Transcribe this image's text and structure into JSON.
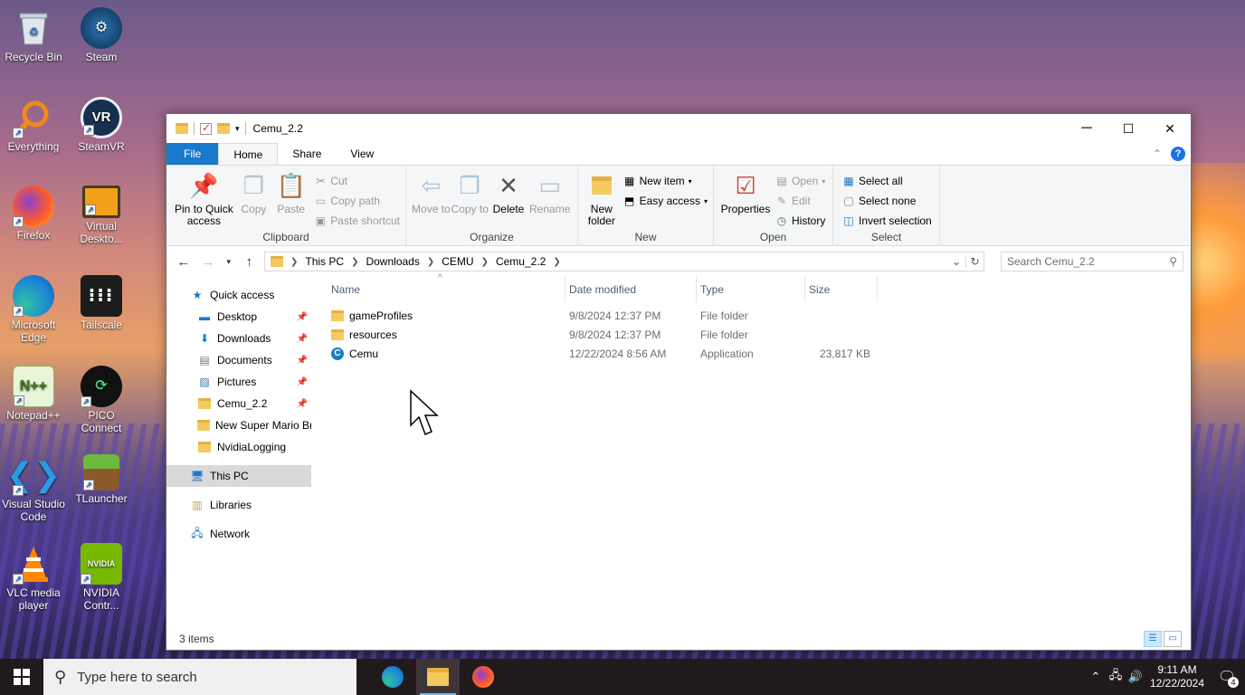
{
  "desktop": {
    "icons": [
      {
        "label": "Recycle Bin"
      },
      {
        "label": "Steam"
      },
      {
        "label": "Everything"
      },
      {
        "label": "SteamVR"
      },
      {
        "label": "Firefox"
      },
      {
        "label": "Virtual Deskto..."
      },
      {
        "label": "Microsoft Edge"
      },
      {
        "label": "Tailscale"
      },
      {
        "label": "Notepad++"
      },
      {
        "label": "PICO Connect"
      },
      {
        "label": "Visual Studio Code"
      },
      {
        "label": "TLauncher"
      },
      {
        "label": "VLC media player"
      },
      {
        "label": "NVIDIA Contr..."
      }
    ]
  },
  "window": {
    "title": "Cemu_2.2",
    "controls": {
      "minimize": "─",
      "maximize": "☐",
      "close": "✕"
    }
  },
  "ribbon": {
    "tabs": [
      "File",
      "Home",
      "Share",
      "View"
    ],
    "active_tab": "Home",
    "clipboard": {
      "label": "Clipboard",
      "pin": "Pin to Quick access",
      "copy": "Copy",
      "paste": "Paste",
      "cut": "Cut",
      "copy_path": "Copy path",
      "paste_shortcut": "Paste shortcut"
    },
    "organize": {
      "label": "Organize",
      "move_to": "Move to",
      "copy_to": "Copy to",
      "delete": "Delete",
      "rename": "Rename"
    },
    "new": {
      "label": "New",
      "new_folder": "New folder",
      "new_item": "New item",
      "easy_access": "Easy access"
    },
    "open": {
      "label": "Open",
      "properties": "Properties",
      "open": "Open",
      "edit": "Edit",
      "history": "History"
    },
    "select": {
      "label": "Select",
      "select_all": "Select all",
      "select_none": "Select none",
      "invert": "Invert selection"
    }
  },
  "address": {
    "crumbs": [
      "This PC",
      "Downloads",
      "CEMU",
      "Cemu_2.2"
    ],
    "search_placeholder": "Search Cemu_2.2"
  },
  "navpane": {
    "quick_access": "Quick access",
    "pinned": [
      {
        "label": "Desktop",
        "icon": "desktop-icon",
        "pinned": true
      },
      {
        "label": "Downloads",
        "icon": "download-icon",
        "pinned": true
      },
      {
        "label": "Documents",
        "icon": "document-icon",
        "pinned": true
      },
      {
        "label": "Pictures",
        "icon": "pictures-icon",
        "pinned": true
      },
      {
        "label": "Cemu_2.2",
        "icon": "folder-icon",
        "pinned": true
      },
      {
        "label": "New Super Mario Br",
        "icon": "folder-icon",
        "pinned": false
      },
      {
        "label": "NvidiaLogging",
        "icon": "folder-icon",
        "pinned": false
      }
    ],
    "this_pc": "This PC",
    "libraries": "Libraries",
    "network": "Network"
  },
  "files": {
    "columns": {
      "name": "Name",
      "date": "Date modified",
      "type": "Type",
      "size": "Size"
    },
    "rows": [
      {
        "name": "gameProfiles",
        "date": "9/8/2024 12:37 PM",
        "type": "File folder",
        "size": "",
        "icon": "folder-icon"
      },
      {
        "name": "resources",
        "date": "9/8/2024 12:37 PM",
        "type": "File folder",
        "size": "",
        "icon": "folder-icon"
      },
      {
        "name": "Cemu",
        "date": "12/22/2024 8:56 AM",
        "type": "Application",
        "size": "23,817 KB",
        "icon": "cemu-app-icon"
      }
    ]
  },
  "status": {
    "items": "3 items"
  },
  "taskbar": {
    "search_placeholder": "Type here to search",
    "time": "9:11 AM",
    "date": "12/22/2024",
    "notification_count": "4"
  },
  "colors": {
    "accent": "#1979ca",
    "file_tab": "#1979ca",
    "folder": "#f4c95d"
  }
}
